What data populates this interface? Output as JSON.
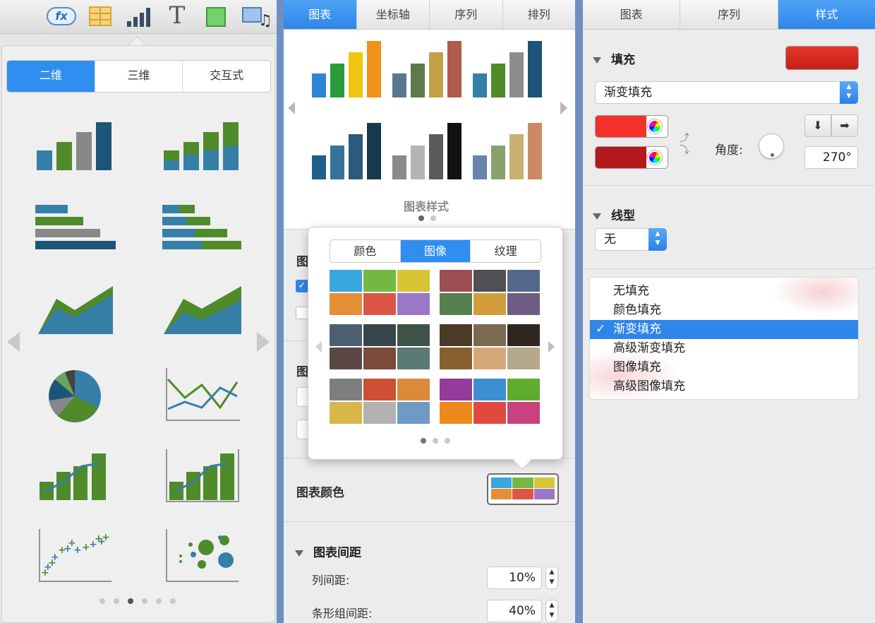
{
  "left_panel": {
    "toolbar_icons": [
      "fx-icon",
      "table-icon",
      "chart-icon",
      "text-icon",
      "shape-icon",
      "media-icon"
    ],
    "fx_label": "fx",
    "text_glyph": "T",
    "segments": [
      "二维",
      "三维",
      "交互式"
    ],
    "selected_segment": "二维",
    "chart_thumbs": [
      "column-chart",
      "stacked-column-chart",
      "bar-chart",
      "stacked-bar-chart",
      "area-chart",
      "stacked-area-chart",
      "pie-chart",
      "line-chart",
      "mixed-chart",
      "two-axis-chart",
      "scatter-chart",
      "bubble-chart"
    ],
    "page_count": 6,
    "current_page": 3
  },
  "middle_panel": {
    "tabs": [
      "图表",
      "坐标轴",
      "序列",
      "排列"
    ],
    "active_tab": "图表",
    "styles_caption": "图表样式",
    "style_pages": 2,
    "hidden_labels": [
      "图",
      "图"
    ],
    "chart_colors_label": "图表颜色",
    "spacing_section": "图表间距",
    "column_gap_label": "列间距:",
    "column_gap_value": "10%",
    "bar_group_gap_label": "条形组间距:",
    "bar_group_gap_value": "40%",
    "popover": {
      "tabs": [
        "颜色",
        "图像",
        "纹理"
      ],
      "active_tab": "图像",
      "page_count": 3
    }
  },
  "right_panel": {
    "tabs": [
      "图表",
      "序列",
      "样式"
    ],
    "active_tab": "样式",
    "fill_section": "填充",
    "fill_type": "渐变填充",
    "angle_label": "角度:",
    "angle_value": "270°",
    "line_section": "线型",
    "line_value": "无",
    "fill_menu": [
      "无填充",
      "颜色填充",
      "渐变填充",
      "高级渐变填充",
      "图像填充",
      "高级图像填充"
    ],
    "fill_menu_selected": "渐变填充",
    "checkmark": "✓",
    "colors": {
      "fill_swatch": "#d8261c",
      "gradient_start": "#f5302a",
      "gradient_end": "#b3191a",
      "accent": "#2f86ea"
    }
  }
}
